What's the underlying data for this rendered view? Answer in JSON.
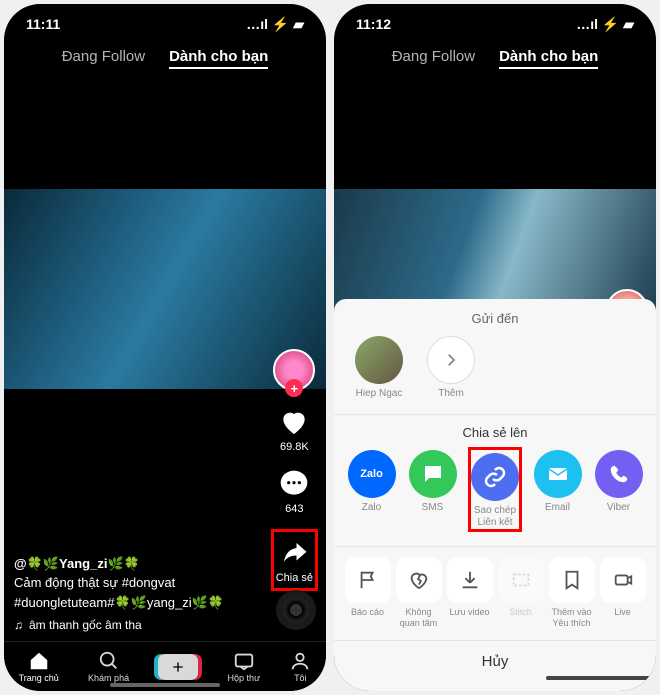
{
  "left": {
    "status": {
      "time": "11:11",
      "indicators": "…ıl ⚡ ▰"
    },
    "tabs": {
      "following": "Đang Follow",
      "for_you": "Dành cho bạn"
    },
    "rail": {
      "like_count": "69.8K",
      "comment_count": "643",
      "share_label": "Chia sẻ"
    },
    "caption": {
      "user": "@🍀🌿Yang_zi🌿🍀",
      "line1": "Cảm động thật sự #dongvat",
      "line2": "#duongletuteam#🍀🌿yang_zi🌿🍀",
      "music": "âm thanh gốc    âm tha"
    },
    "nav": {
      "home": "Trang chủ",
      "discover": "Khám phá",
      "inbox": "Hộp thư",
      "me": "Tôi"
    }
  },
  "right": {
    "status": {
      "time": "11:12",
      "indicators": "…ıl ⚡ ▰"
    },
    "tabs": {
      "following": "Đang Follow",
      "for_you": "Dành cho bạn"
    },
    "sheet": {
      "send_to": "Gửi đến",
      "contacts": [
        {
          "name": "Hiep Ngac"
        },
        {
          "name": "Thêm"
        }
      ],
      "share_title": "Chia sẻ lên",
      "share_targets": {
        "zalo": "Zalo",
        "sms": "SMS",
        "copy_link": "Sao chép Liên kết",
        "email": "Email",
        "viber": "Viber"
      },
      "actions": {
        "report": "Báo cáo",
        "not_interested": "Không quan tâm",
        "save": "Lưu video",
        "stitch": "Stitch",
        "favorite": "Thêm vào Yêu thích",
        "live": "Live"
      },
      "cancel": "Hủy"
    }
  }
}
